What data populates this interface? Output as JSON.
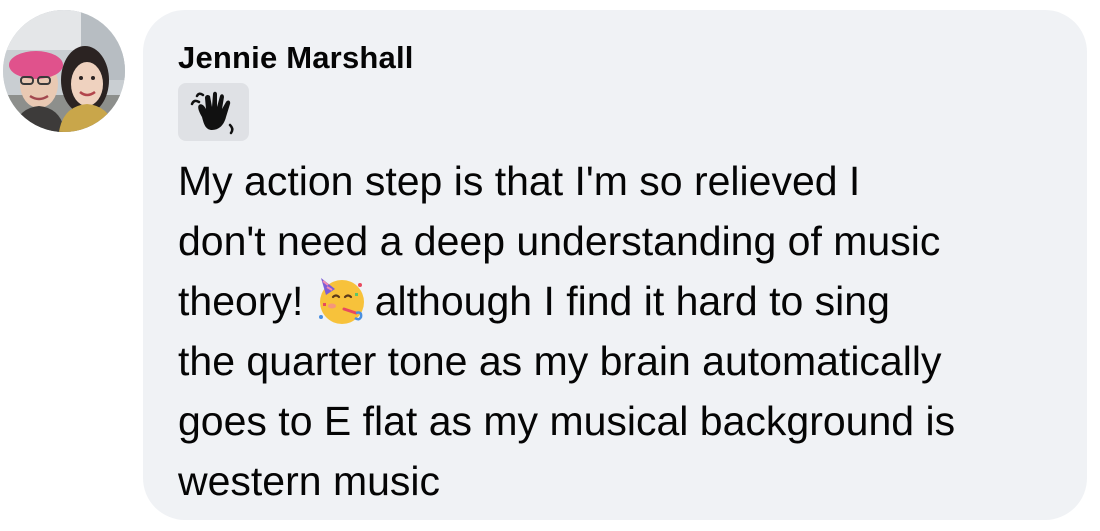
{
  "comment": {
    "author": "Jennie Marshall",
    "badge_icon": "waving-hand-icon",
    "text_lines": [
      "My action step is that I'm so relieved I",
      "don't need a deep understanding of music",
      "theory!",
      "although I find it hard to sing",
      "the quarter tone as my brain automatically",
      "goes to E flat as my musical background is",
      "western music"
    ],
    "emoji": "partying-face-icon"
  },
  "colors": {
    "bubble_bg": "#f0f2f5",
    "badge_bg": "#dfe1e5",
    "text": "#050505"
  }
}
